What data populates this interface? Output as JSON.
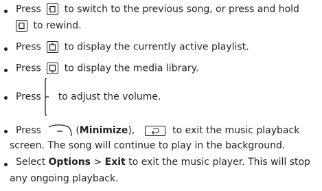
{
  "items": [
    {
      "lines": [
        {
          "before": "Press",
          "after": "to switch to the previous song, or press and hold"
        },
        {
          "before": "",
          "after": "to rewind."
        }
      ],
      "icons": [
        "left-key-icon",
        "left-key-icon"
      ]
    },
    {
      "lines": [
        {
          "before": "Press",
          "after": "to display the currently active playlist."
        }
      ],
      "icons": [
        "up-key-icon"
      ]
    },
    {
      "lines": [
        {
          "before": "Press",
          "after": "to display the media library."
        }
      ],
      "icons": [
        "down-key-icon"
      ]
    },
    {
      "lines": [
        {
          "before": "Press",
          "after": "to adjust the volume."
        }
      ],
      "icons": [
        "volume-key-icon"
      ]
    },
    {
      "lines": [
        {
          "before": "Press",
          "open": "(",
          "bold": "Minimize",
          "close": "),",
          "after": "to exit the music playback"
        },
        {
          "text": "screen. The song will continue to play in the background."
        }
      ],
      "icons": [
        "right-softkey-icon",
        "back-key-icon"
      ]
    },
    {
      "lines": [
        {
          "before": "Select",
          "bold1": "Options",
          "sep": ">",
          "bold2": "Exit",
          "after": "to exit the music player. This will stop"
        },
        {
          "text": "any ongoing playback."
        }
      ]
    }
  ]
}
